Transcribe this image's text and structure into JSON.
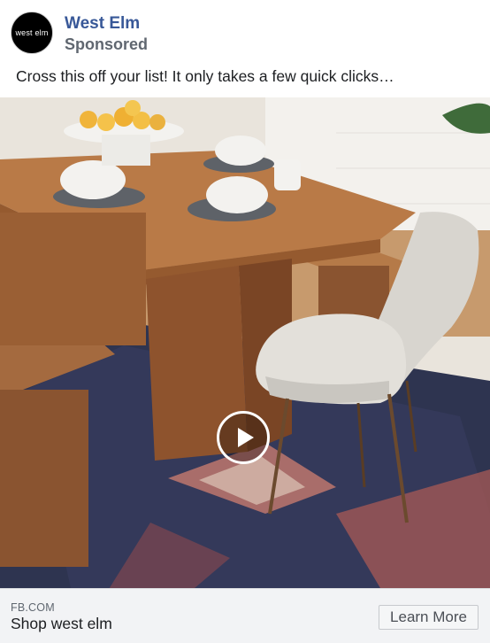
{
  "post": {
    "avatar_text": "west elm",
    "page_name": "West Elm",
    "sponsored_label": "Sponsored",
    "ad_text": "Cross this off your list! It only takes a few quick clicks…"
  },
  "media": {
    "type": "video",
    "play_icon": "play-icon"
  },
  "link_card": {
    "domain": "FB.COM",
    "headline": "Shop west elm",
    "cta_label": "Learn More"
  },
  "colors": {
    "page_name": "#385898",
    "sponsored": "#606770",
    "footer_bg": "#f2f3f5"
  }
}
